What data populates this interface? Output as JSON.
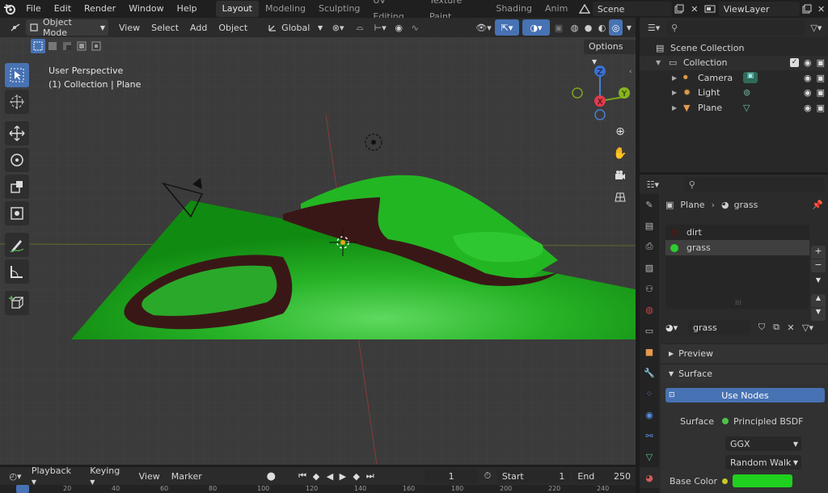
{
  "topbar": {
    "menus": [
      "File",
      "Edit",
      "Render",
      "Window",
      "Help"
    ],
    "workspaces": [
      "Layout",
      "Modeling",
      "Sculpting",
      "UV Editing",
      "Texture Paint",
      "Shading",
      "Anim"
    ],
    "active_workspace": "Layout",
    "scene": "Scene",
    "view_layer": "ViewLayer"
  },
  "viewport_header": {
    "mode": "Object Mode",
    "menus": [
      "View",
      "Select",
      "Add",
      "Object"
    ],
    "orientation": "Global",
    "options": "Options"
  },
  "viewport": {
    "info_line1": "User Perspective",
    "info_line2": "(1) Collection | Plane",
    "gizmo": {
      "z": "Z",
      "y": "Y",
      "x": "X"
    }
  },
  "timeline": {
    "menus": [
      "Playback",
      "Keying",
      "View",
      "Marker"
    ],
    "current_frame": "1",
    "start_label": "Start",
    "start": "1",
    "end_label": "End",
    "end": "250",
    "ruler": [
      "0",
      "20",
      "40",
      "60",
      "80",
      "100",
      "120",
      "140",
      "160",
      "180",
      "200",
      "220",
      "240"
    ]
  },
  "outliner": {
    "scene_collection": "Scene Collection",
    "collection": "Collection",
    "items": [
      "Camera",
      "Light",
      "Plane"
    ]
  },
  "properties": {
    "breadcrumb_object": "Plane",
    "breadcrumb_material": "grass",
    "slots": [
      "dirt",
      "grass"
    ],
    "material_name": "grass",
    "preview_label": "Preview",
    "surface_label": "Surface",
    "use_nodes": "Use Nodes",
    "surface_field_label": "Surface",
    "surface_shader": "Principled BSDF",
    "distribution": "GGX",
    "subsurface": "Random Walk",
    "base_color_label": "Base Color",
    "base_color": "#1fd01f"
  },
  "colors": {
    "accent": "#4772b3",
    "grass": "#1fbf1f",
    "dirt": "#3a1717"
  }
}
